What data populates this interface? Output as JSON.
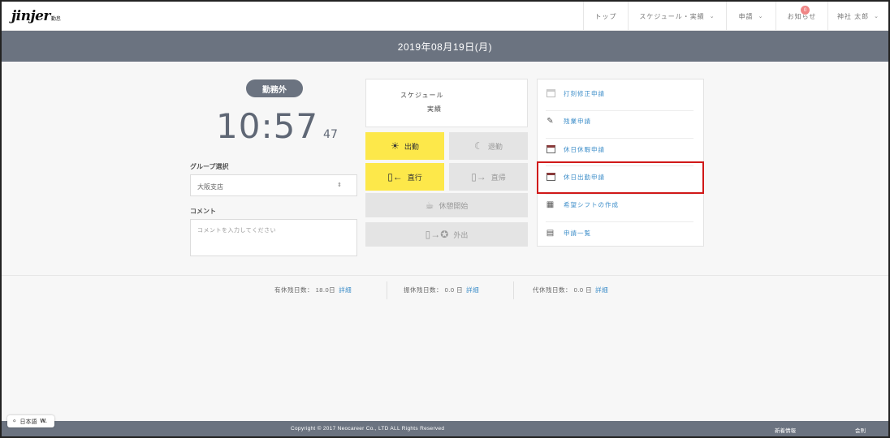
{
  "header": {
    "logo_text": "jinjer",
    "logo_sub": "勤怠",
    "nav": [
      {
        "label": "トップ",
        "chevron": false
      },
      {
        "label": "スケジュール・実績",
        "chevron": true
      },
      {
        "label": "申請",
        "chevron": true
      },
      {
        "label": "お知らせ",
        "chevron": false,
        "badge": "0"
      },
      {
        "label": "神社 太郎",
        "chevron": true
      }
    ]
  },
  "datebar": {
    "date": "2019年08月19日(月)"
  },
  "status": {
    "label": "勤務外"
  },
  "clock": {
    "hm": "10:57",
    "sec": "47"
  },
  "group": {
    "label": "グループ選択",
    "value": "大阪支店"
  },
  "comment": {
    "label": "コメント",
    "placeholder": "コメントを入力してください"
  },
  "schedule": {
    "line1": "スケジュール",
    "line2": "実績"
  },
  "punch_buttons": {
    "clock_in": "出勤",
    "clock_out": "退勤",
    "direct_in": "直行",
    "direct_out": "直帰",
    "break_start": "休憩開始",
    "go_out": "外出"
  },
  "menu": [
    {
      "label": "打刻修正申請",
      "icon": "calendar-icon"
    },
    {
      "label": "残業申請",
      "icon": "edit-icon"
    },
    {
      "label": "休日休暇申請",
      "icon": "calendar-icon"
    },
    {
      "label": "休日出勤申請",
      "icon": "calendar-icon"
    },
    {
      "label": "希望シフトの作成",
      "icon": "shift-icon"
    },
    {
      "label": "申請一覧",
      "icon": "list-icon"
    }
  ],
  "leave": [
    {
      "text": "有休残日数： 18.0日",
      "link": "詳細"
    },
    {
      "text": "振休残日数： 0.0 日",
      "link": "詳細"
    },
    {
      "text": "代休残日数： 0.0 日",
      "link": "詳細"
    }
  ],
  "footer": {
    "copyright": "Copyright © 2017 Neocareer Co., LTD ALL Rights Reserved",
    "news": "新着情報",
    "terms": "会則"
  },
  "language": {
    "label": "日本語",
    "w": "W."
  },
  "colors": {
    "accent_yellow": "#fde84a",
    "header_gray": "#6b7380",
    "link_blue": "#3d8ec9",
    "highlight_red": "#d01818"
  }
}
